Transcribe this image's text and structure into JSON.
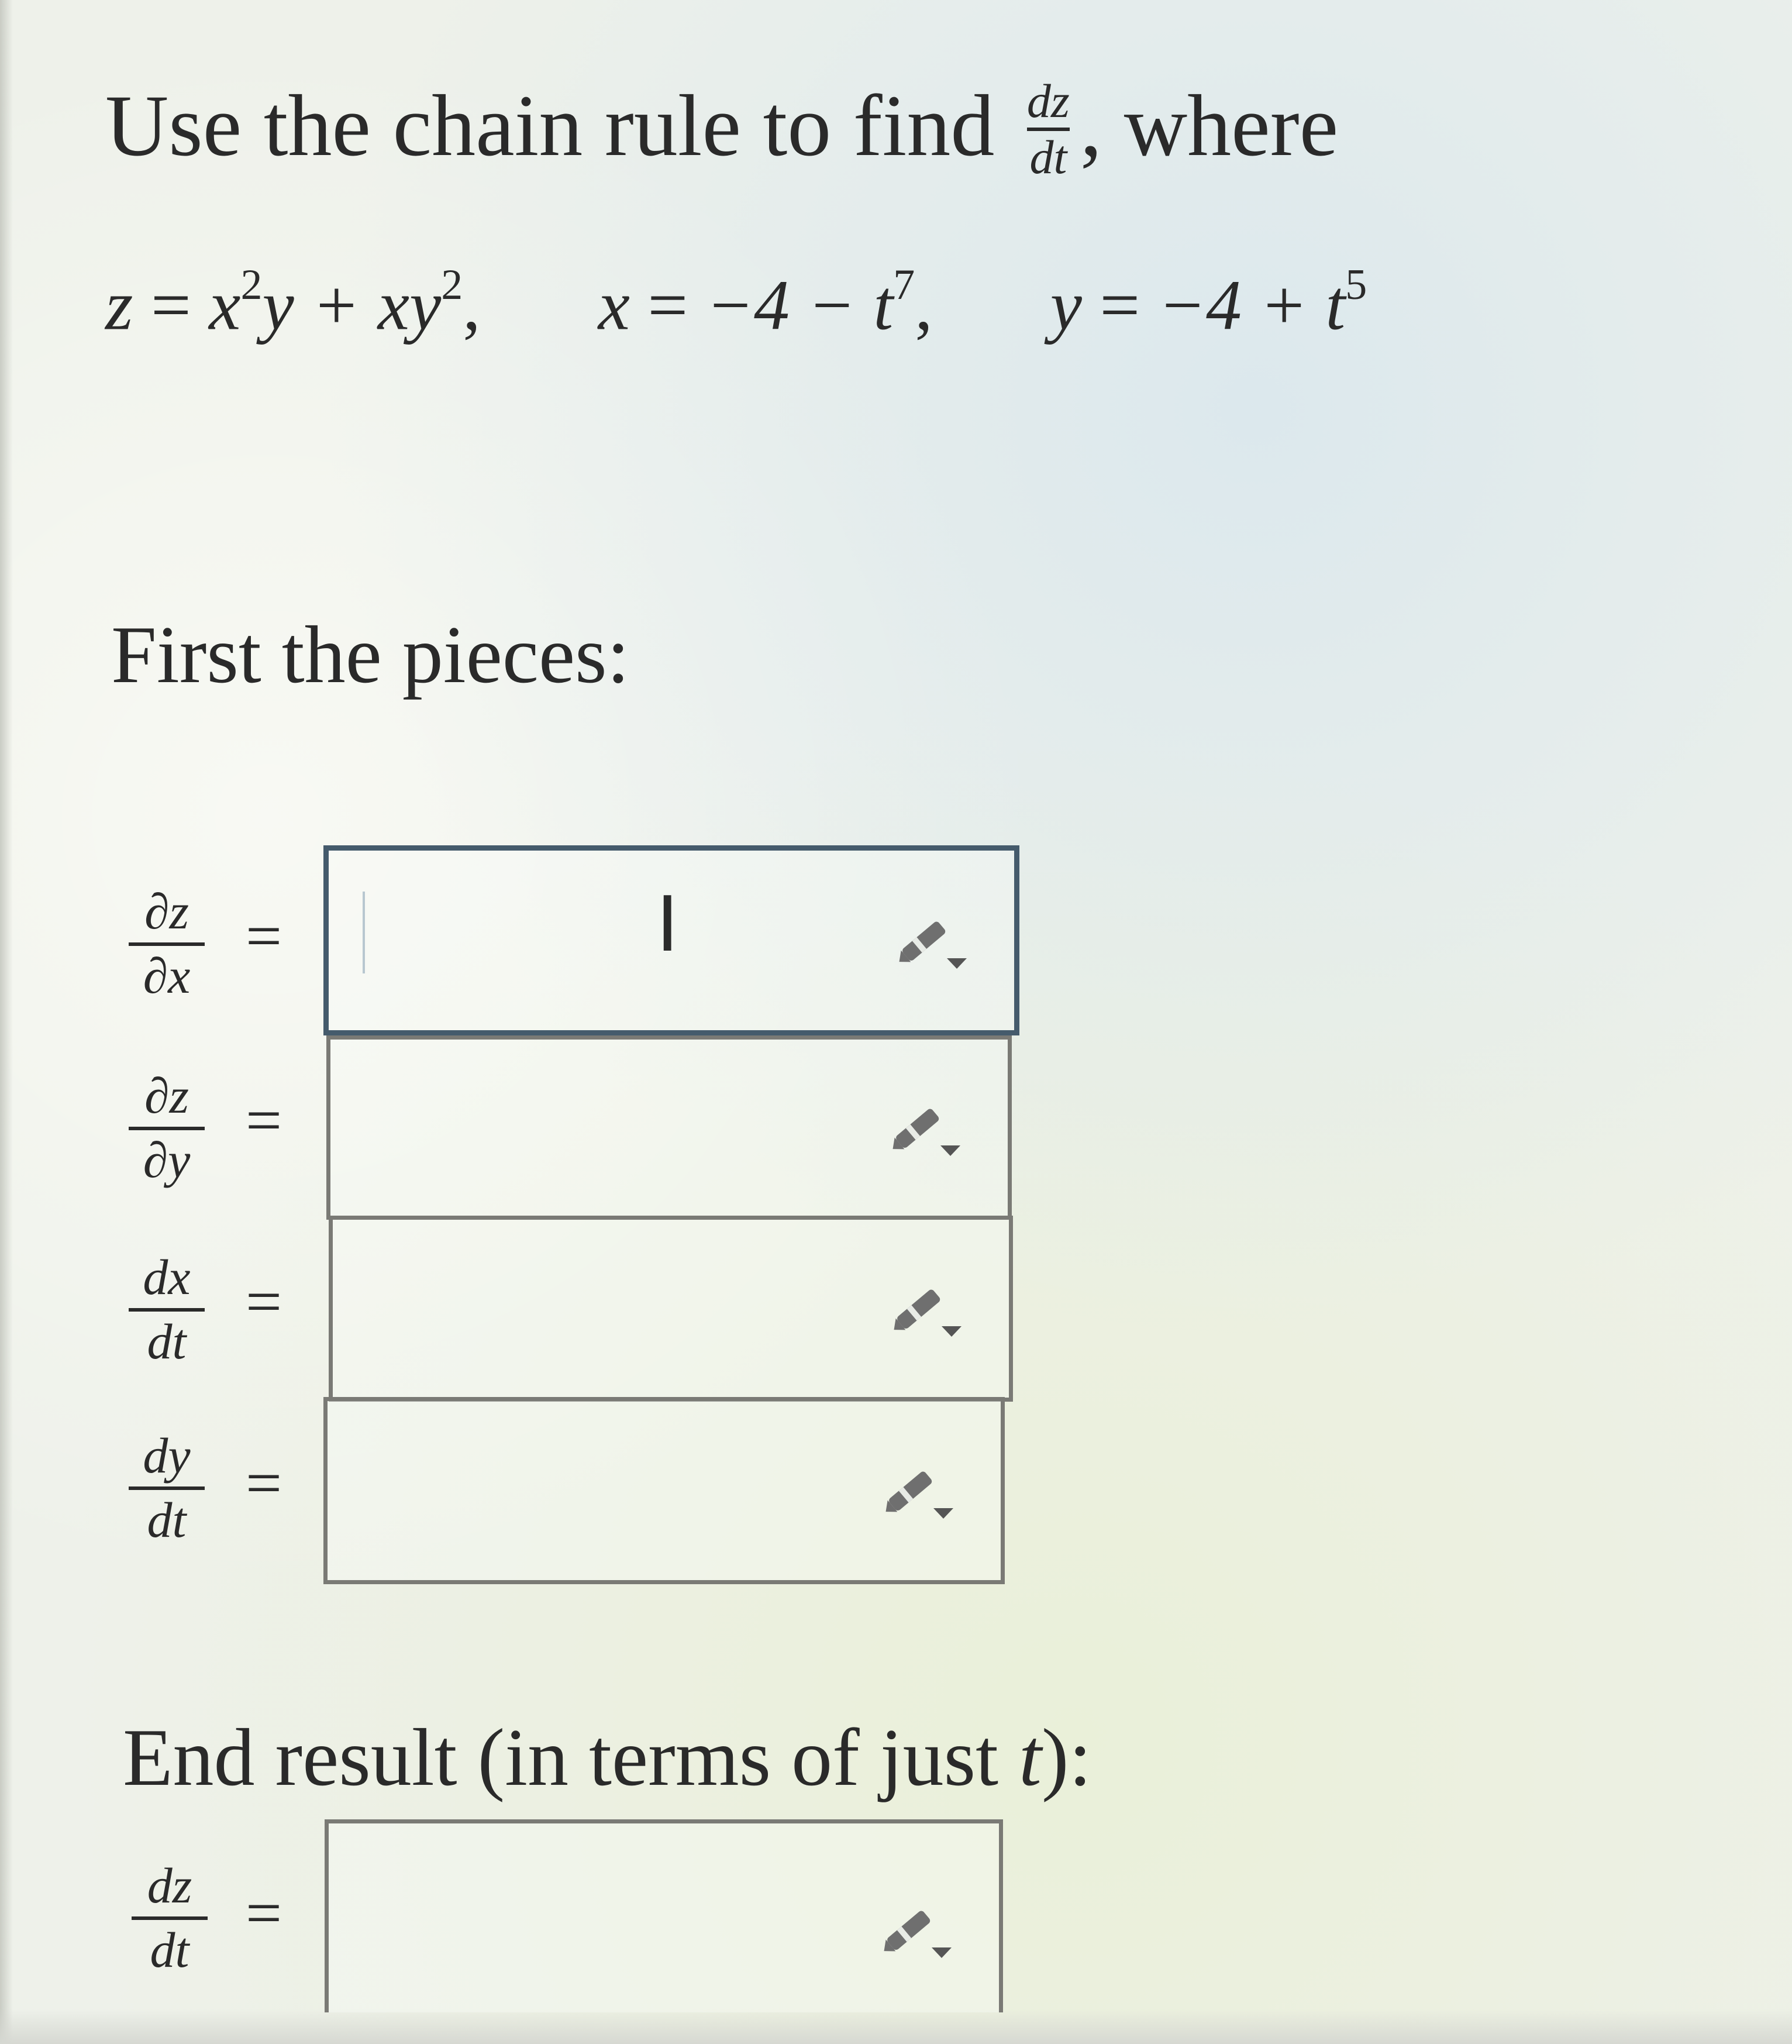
{
  "question": {
    "intro_prefix": "Use the chain rule to find",
    "intro_frac_num": "dz",
    "intro_frac_den": "dt",
    "intro_suffix": ", where",
    "equation": {
      "z_lhs": "z",
      "z_rhs_1": "x",
      "z_rhs_1_exp": "2",
      "z_rhs_2": "y + xy",
      "z_rhs_2_exp": "2",
      "x_lhs": "x",
      "x_rhs": "−4 − t",
      "x_exp": "7",
      "y_lhs": "y",
      "y_rhs": "−4 + t",
      "y_exp": "5"
    }
  },
  "pieces": {
    "title": "First the pieces:",
    "rows": [
      {
        "numerator": "∂z",
        "denominator": "∂x",
        "equals": "=",
        "value": ""
      },
      {
        "numerator": "∂z",
        "denominator": "∂y",
        "equals": "=",
        "value": ""
      },
      {
        "numerator": "dx",
        "denominator": "dt",
        "equals": "=",
        "value": ""
      },
      {
        "numerator": "dy",
        "denominator": "dt",
        "equals": "=",
        "value": ""
      }
    ]
  },
  "result": {
    "title_prefix": "End result (in terms of just ",
    "title_var": "t",
    "title_suffix": "):",
    "numerator": "dz",
    "denominator": "dt",
    "equals": "=",
    "value": ""
  },
  "icons": {
    "edit": "pencil-dropdown-icon",
    "cursor": "text-cursor-icon"
  },
  "colors": {
    "focus_border": "#455b6c",
    "box_border": "#7a7a75",
    "pencil": "#6f6f6f"
  }
}
